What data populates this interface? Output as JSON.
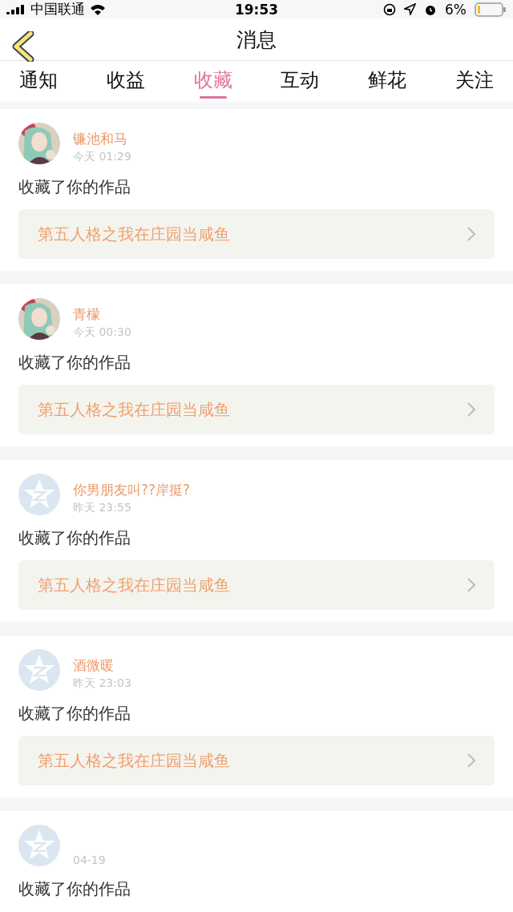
{
  "status_bar": {
    "carrier": "中国联通",
    "time": "19:53",
    "battery": "6%"
  },
  "nav": {
    "title": "消息"
  },
  "tabs": [
    {
      "label": "通知",
      "selected": false
    },
    {
      "label": "收益",
      "selected": false
    },
    {
      "label": "收藏",
      "selected": true
    },
    {
      "label": "互动",
      "selected": false
    },
    {
      "label": "鲜花",
      "selected": false
    },
    {
      "label": "关注",
      "selected": false
    }
  ],
  "messages": [
    {
      "name": "镰池和马",
      "time": "今天 01:29",
      "text": "收藏了你的作品",
      "work": "第五人格之我在庄园当咸鱼"
    },
    {
      "name": "青檬",
      "time": "今天 00:30",
      "text": "收藏了你的作品",
      "work": "第五人格之我在庄园当咸鱼"
    },
    {
      "avatar": {
        "kind": "default"
      },
      "name": "你男朋友叫??岸挺?",
      "time": "昨天 23:55",
      "text": "收藏了你的作品",
      "work": "第五人格之我在庄园当咸鱼"
    },
    {
      "avatar": {
        "kind": "default"
      },
      "name": "酒微暖",
      "time": "昨天 23:03",
      "text": "收藏了你的作品",
      "work": "第五人格之我在庄园当咸鱼"
    },
    {
      "avatar": {
        "kind": "default"
      },
      "time": "04-19",
      "text": "收藏了你的作品"
    }
  ]
}
